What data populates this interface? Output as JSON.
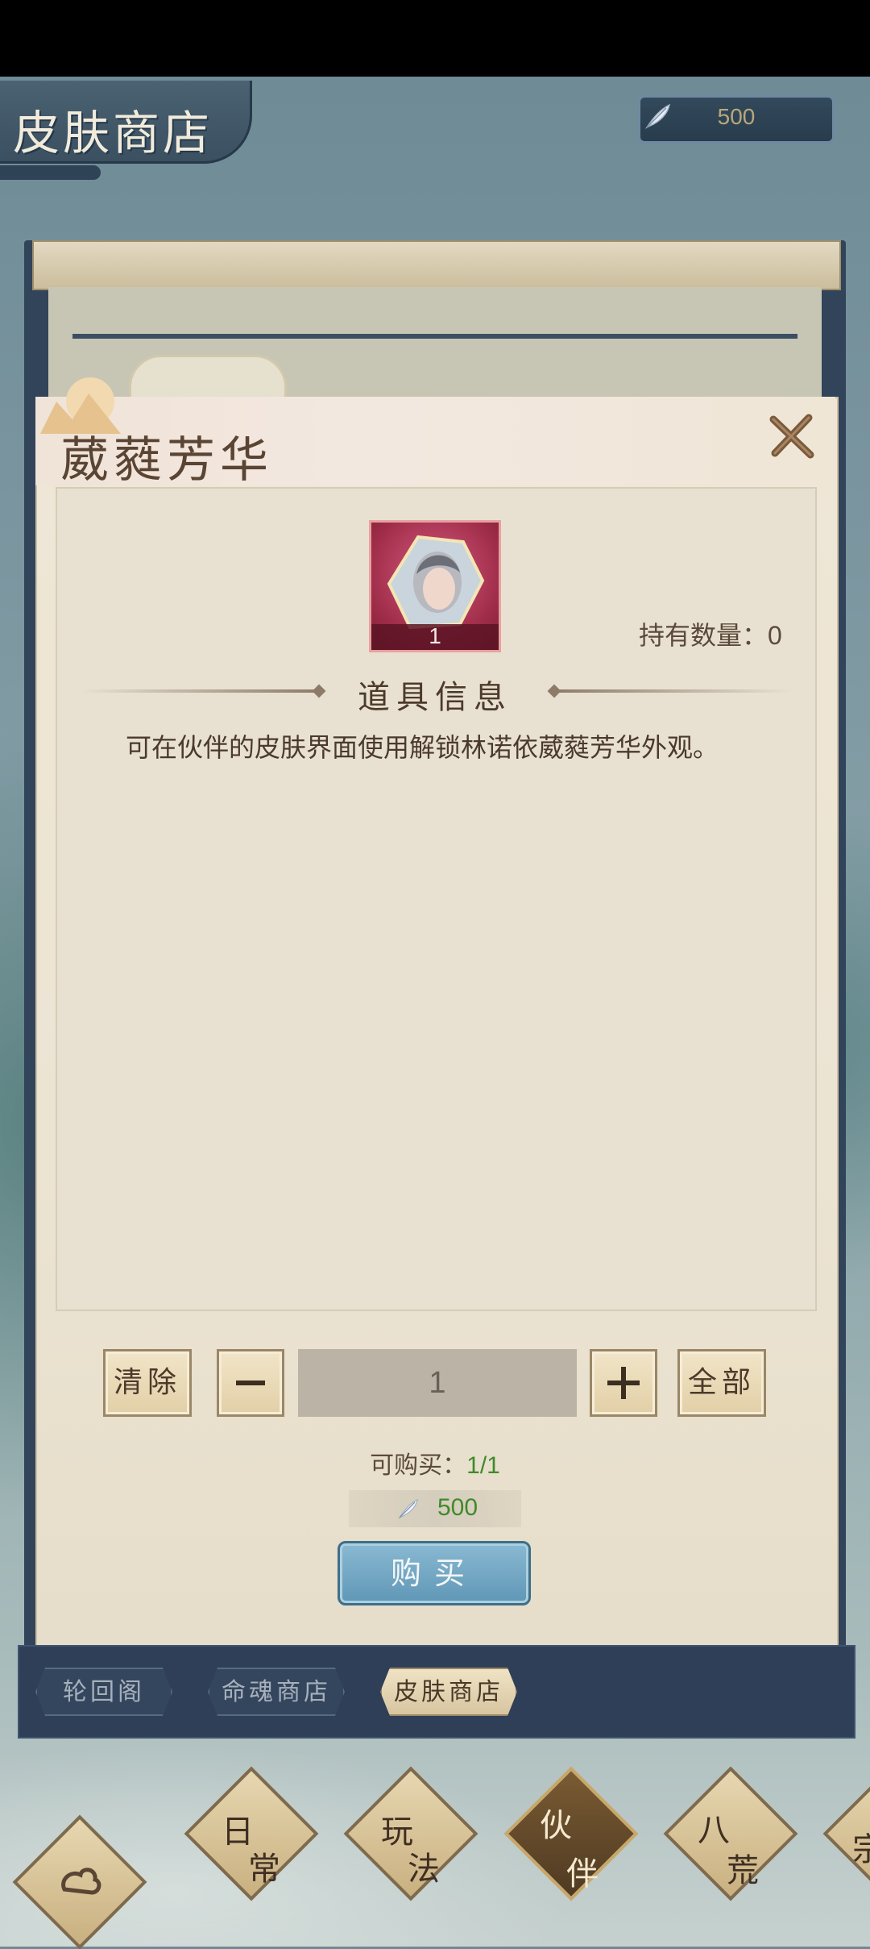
{
  "header": {
    "title": "皮肤商店",
    "currency_value": "500",
    "currency_icon": "feather-icon"
  },
  "dialog": {
    "title": "葳蕤芳华",
    "item": {
      "count": "1",
      "icon": "partner-portrait-icon"
    },
    "hold_label": "持有数量：0",
    "section_title": "道具信息",
    "description": "可在伙伴的皮肤界面使用解锁林诺依葳蕤芳华外观。",
    "quantity": {
      "clear_label": "清除",
      "value": "1",
      "all_label": "全部"
    },
    "buyable_label": "可购买：",
    "buyable_value": "1/1",
    "price": "500",
    "buy_label": "购买"
  },
  "tabs": [
    {
      "label": "轮回阁",
      "active": false
    },
    {
      "label": "命魂商店",
      "active": false
    },
    {
      "label": "皮肤商店",
      "active": true
    }
  ],
  "nav": [
    {
      "label": "",
      "icon": "cloud-emblem-icon"
    },
    {
      "label_top": "日",
      "label_bottom": "常"
    },
    {
      "label_top": "玩",
      "label_bottom": "法"
    },
    {
      "label_top": "伙",
      "label_bottom": "伴",
      "active": true
    },
    {
      "label_top": "八",
      "label_bottom": "荒"
    },
    {
      "label_top": "宗"
    }
  ],
  "colors": {
    "accent_green": "#3f8a2a",
    "buy_button": "#5f97b6",
    "tab_bar": "#2e3f57"
  }
}
